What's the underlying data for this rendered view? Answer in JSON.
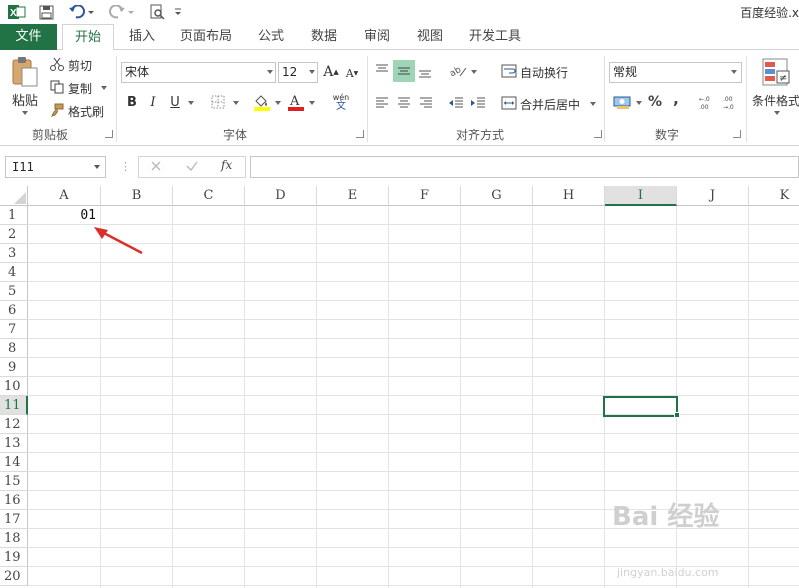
{
  "window": {
    "title": "百度经验.x"
  },
  "ribbon_tabs": [
    "文件",
    "开始",
    "插入",
    "页面布局",
    "公式",
    "数据",
    "审阅",
    "视图",
    "开发工具"
  ],
  "clipboard": {
    "paste": "粘贴",
    "cut": "剪切",
    "copy": "复制",
    "format_painter": "格式刷",
    "group": "剪贴板"
  },
  "font": {
    "name": "宋体",
    "size": "12",
    "bold": "B",
    "italic": "I",
    "underline": "U",
    "group": "字体",
    "phonetic": "wén"
  },
  "alignment": {
    "wrap": "自动换行",
    "merge": "合并后居中",
    "group": "对齐方式"
  },
  "number": {
    "format": "常规",
    "percent": "%",
    "comma": ",",
    "group": "数字"
  },
  "styles": {
    "conditional": "条件格式"
  },
  "formula_bar": {
    "name_box": "I11",
    "fx": "fx"
  },
  "columns": [
    "A",
    "B",
    "C",
    "D",
    "E",
    "F",
    "G",
    "H",
    "I",
    "J",
    "K"
  ],
  "rows": [
    "1",
    "2",
    "3",
    "4",
    "5",
    "6",
    "7",
    "8",
    "9",
    "10",
    "11",
    "12",
    "13",
    "14",
    "15",
    "16",
    "17",
    "18",
    "19",
    "20"
  ],
  "cells": {
    "A1": "01"
  },
  "selection": {
    "column": "I",
    "row": "11"
  },
  "watermark": {
    "main": "Bai 经验",
    "sub": "jingyan.baidu.com"
  },
  "colors": {
    "accent": "#217346",
    "arrow": "#d9302b"
  }
}
